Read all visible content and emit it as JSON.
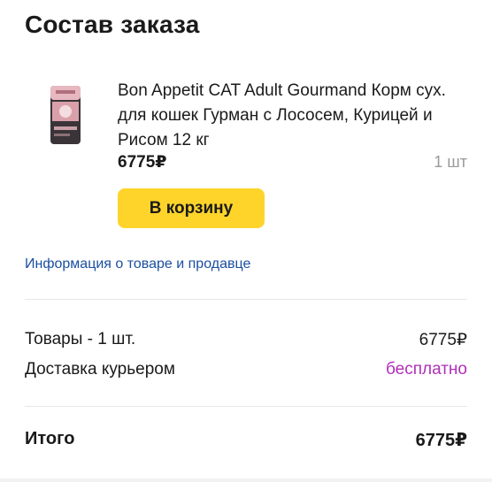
{
  "header": {
    "title": "Состав заказа"
  },
  "product": {
    "image_icon": "cat-food-bag-image",
    "name": "Bon Appetit CAT Adult Gourmand Корм сух. для кошек Гурман с Лососем, Курицей и Рисом 12 кг",
    "price": "6775₽",
    "quantity": "1 шт",
    "cart_button_label": "В корзину",
    "info_link": "Информация о товаре и продавце"
  },
  "summary": {
    "goods_label": "Товары - 1 шт.",
    "goods_value": "6775₽",
    "delivery_label": "Доставка курьером",
    "delivery_value": "бесплатно",
    "total_label": "Итого",
    "total_value": "6775₽"
  },
  "colors": {
    "accent_button": "#fed42b",
    "link": "#1a4fa0",
    "free_delivery": "#b02fb9",
    "muted_text": "#9a9a9a"
  }
}
